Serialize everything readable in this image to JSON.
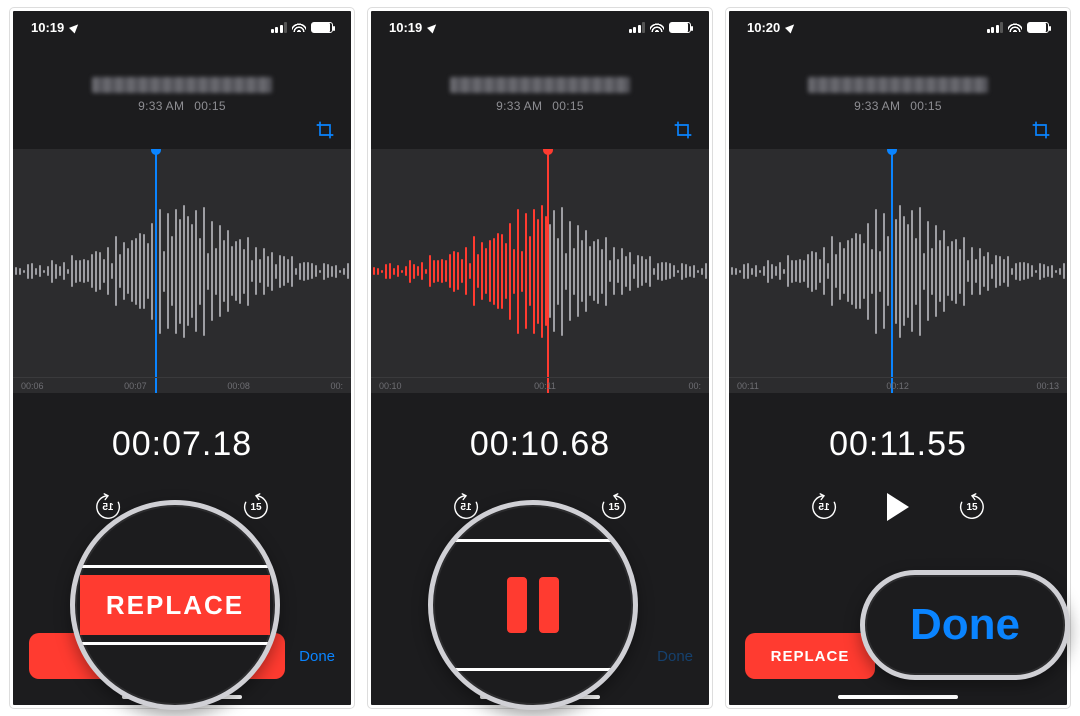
{
  "screens": [
    {
      "status_time": "10:19",
      "meta_time": "9:33 AM",
      "meta_dur": "00:15",
      "timer": "00:07.18",
      "ruler": [
        "00:06",
        "00:07",
        "00:08",
        "00:"
      ],
      "playhead_color": "blue",
      "playhead_left": "42%",
      "done_dim": false,
      "bottom_mode": "replace"
    },
    {
      "status_time": "10:19",
      "meta_time": "9:33 AM",
      "meta_dur": "00:15",
      "timer": "00:10.68",
      "ruler": [
        "00:10",
        "00:11",
        "00:"
      ],
      "playhead_color": "red",
      "playhead_left": "52%",
      "done_dim": true,
      "bottom_mode": "pause"
    },
    {
      "status_time": "10:20",
      "meta_time": "9:33 AM",
      "meta_dur": "00:15",
      "timer": "00:11.55",
      "ruler": [
        "00:11",
        "00:12",
        "00:13"
      ],
      "playhead_color": "blue",
      "playhead_left": "48%",
      "done_dim": false,
      "bottom_mode": "play"
    }
  ],
  "labels": {
    "replace": "REPLACE",
    "done": "Done",
    "skip": "15"
  },
  "bubbles": {
    "replace": "REPLACE",
    "done": "Done"
  }
}
